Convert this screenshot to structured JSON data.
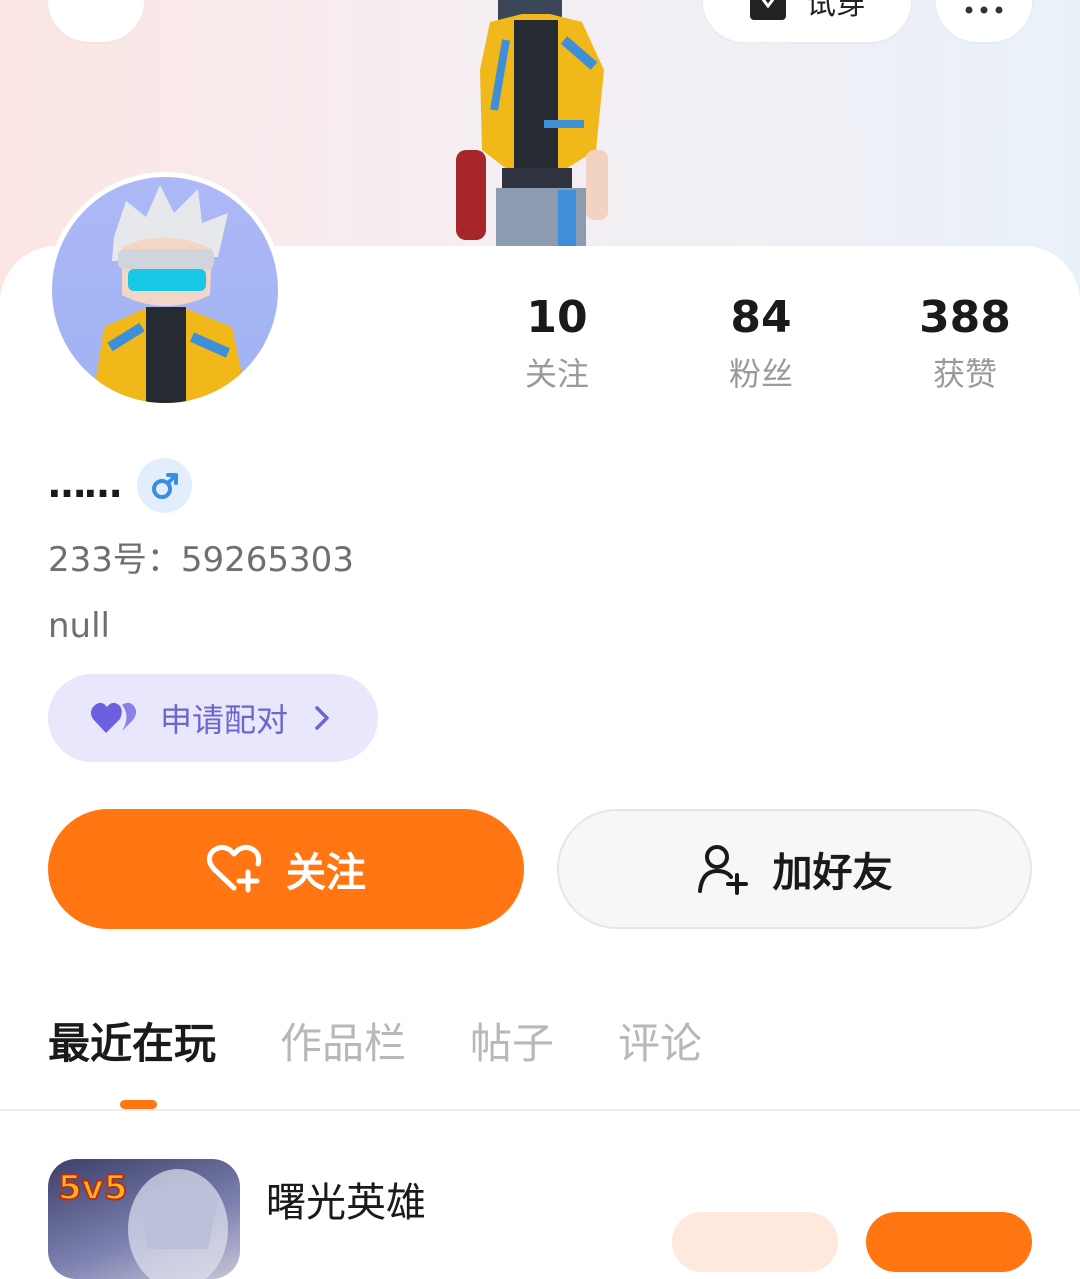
{
  "header": {
    "back_icon": "back-chevron-icon",
    "tryon_label": "试穿",
    "tryon_icon": "shirt-icon",
    "more_icon": "more-dots-icon"
  },
  "profile": {
    "username": "……",
    "gender_icon": "male-icon",
    "uid": "233号：59265303",
    "bio": "null",
    "pair_label": "申请配对",
    "pair_icon": "heart-pair-icon"
  },
  "stats": [
    {
      "value": "10",
      "label": "关注"
    },
    {
      "value": "84",
      "label": "粉丝"
    },
    {
      "value": "388",
      "label": "获赞"
    }
  ],
  "actions": {
    "follow_label": "关注",
    "follow_icon": "heart-plus-icon",
    "add_friend_label": "加好友",
    "add_friend_icon": "user-plus-icon"
  },
  "tabs": [
    {
      "label": "最近在玩",
      "active": true
    },
    {
      "label": "作品栏",
      "active": false
    },
    {
      "label": "帖子",
      "active": false
    },
    {
      "label": "评论",
      "active": false
    }
  ],
  "recent_game": {
    "name": "曙光英雄",
    "icon_badge": "5v5"
  },
  "colors": {
    "accent": "#ff7613",
    "pair_bg": "#e9e7fb",
    "pair_text": "#6e65cf",
    "male_blue": "#3a8de0"
  }
}
